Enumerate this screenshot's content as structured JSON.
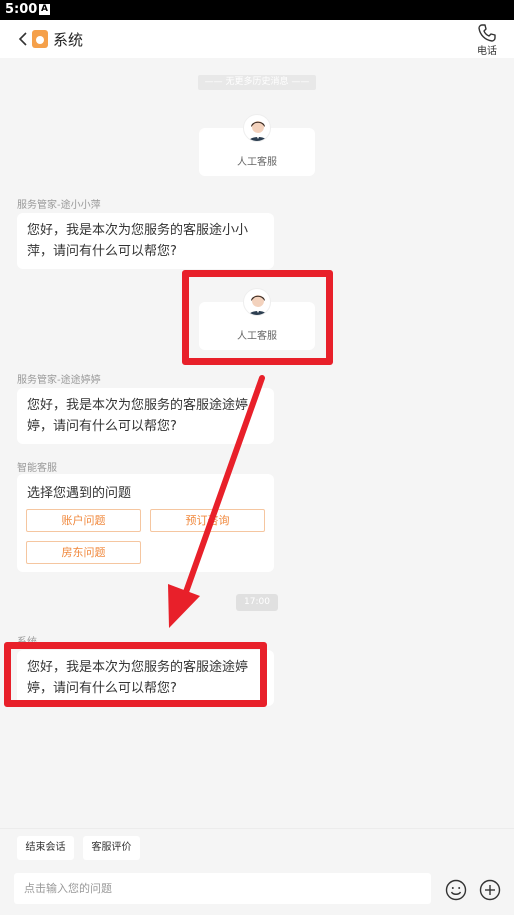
{
  "status_bar": {
    "time": "5:00",
    "notification": "A"
  },
  "header": {
    "title": "系统",
    "phone_label": "电话"
  },
  "history": {
    "no_more": "—— 无更多历史消息 ——"
  },
  "agent_cards": [
    {
      "label": "人工客服"
    },
    {
      "label": "人工客服"
    }
  ],
  "messages": [
    {
      "sender": "服务管家-途小小萍",
      "text": "您好，我是本次为您服务的客服途小小萍，请问有什么可以帮您?"
    },
    {
      "sender": "服务管家-途途婷婷",
      "text": "您好，我是本次为您服务的客服途途婷婷，请问有什么可以帮您?"
    },
    {
      "sender": "系统",
      "text": "您好，我是本次为您服务的客服途途婷婷，请问有什么可以帮您?"
    }
  ],
  "smart_service": {
    "sender": "智能客服",
    "title": "选择您遇到的问题",
    "options": [
      "账户问题",
      "预订咨询",
      "房东问题"
    ]
  },
  "timestamp": "17:00",
  "quick_actions": [
    "结束会话",
    "客服评价"
  ],
  "composer": {
    "placeholder": "点击输入您的问题"
  },
  "colors": {
    "accent": "#f0883c",
    "annotation": "#e8202a"
  }
}
